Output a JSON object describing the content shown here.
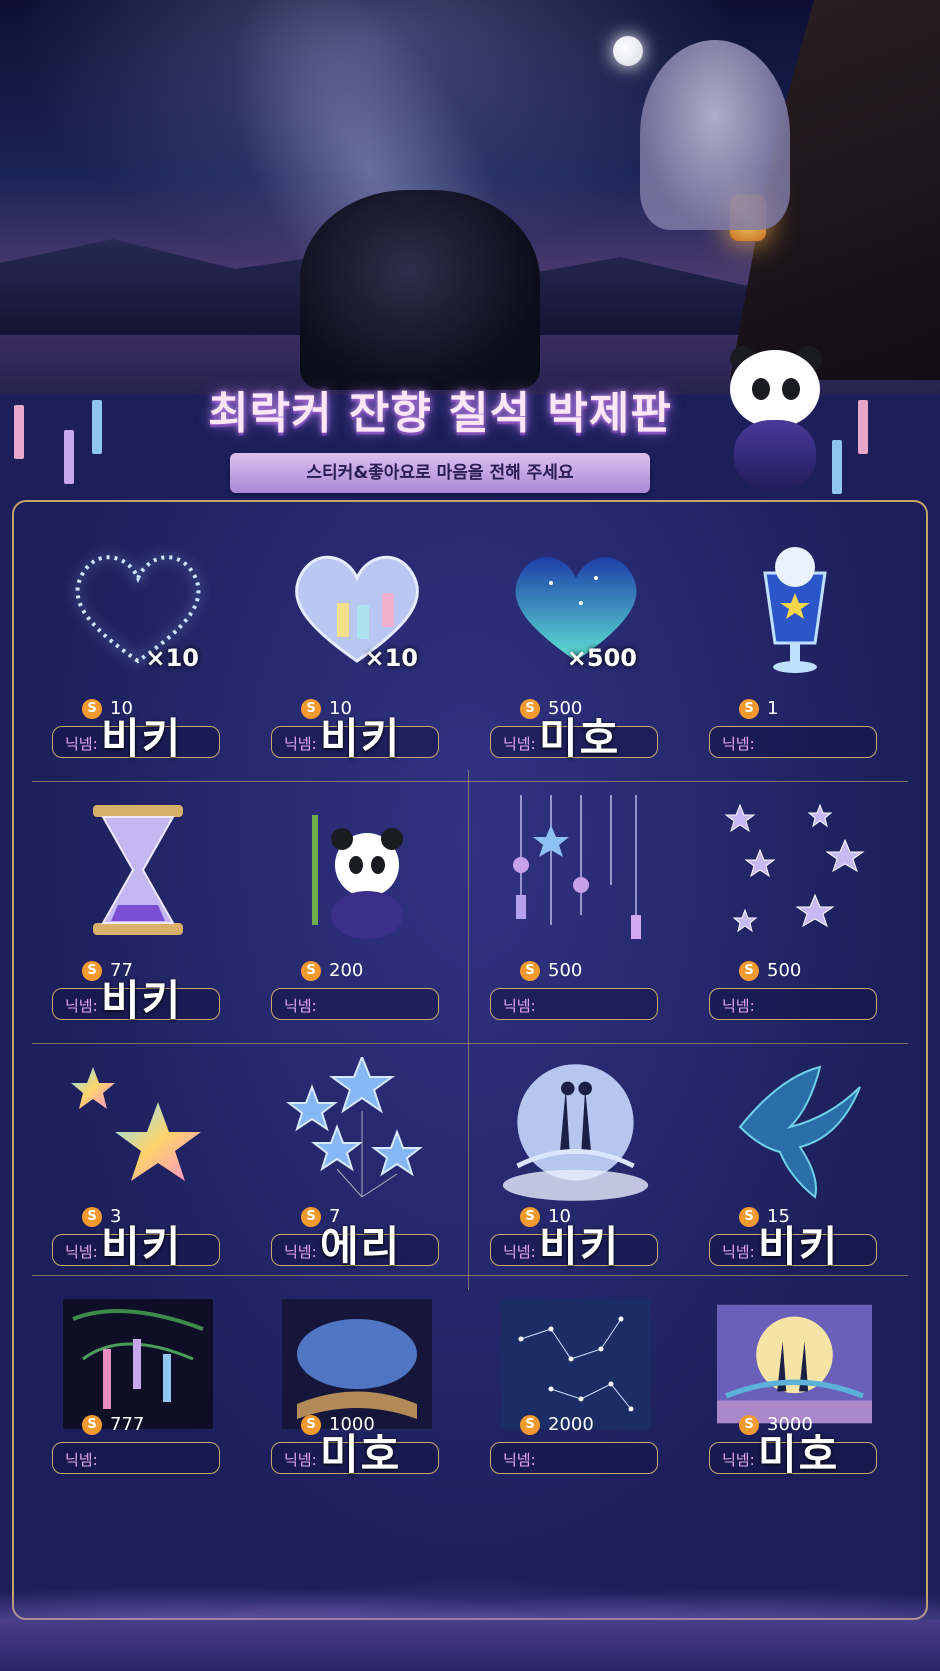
{
  "title": "최락커 잔향 칠석 박제판",
  "subtitle": "스티커&좋아요로 마음을 전해 주세요",
  "coin_symbol": "S",
  "nickname_label": "닉넴:",
  "colors": {
    "accent": "#c9a76d",
    "coin": "#f29a2e",
    "label": "#e8a7f0",
    "background": "#1c1f5a"
  },
  "rows": [
    [
      {
        "icon": "sparkle-heart-icon",
        "multiplier": "×10",
        "price": "10",
        "nickname": "비키"
      },
      {
        "icon": "glass-heart-icon",
        "multiplier": "×10",
        "price": "10",
        "nickname": "비키"
      },
      {
        "icon": "starry-heart-icon",
        "multiplier": "×500",
        "price": "500",
        "nickname": "미호"
      },
      {
        "icon": "starry-drink-icon",
        "multiplier": "",
        "price": "1",
        "nickname": ""
      }
    ],
    [
      {
        "icon": "hourglass-icon",
        "multiplier": "",
        "price": "77",
        "nickname": "비키"
      },
      {
        "icon": "panda-bamboo-icon",
        "multiplier": "",
        "price": "200",
        "nickname": ""
      },
      {
        "icon": "wind-chimes-icon",
        "multiplier": "",
        "price": "500",
        "nickname": ""
      },
      {
        "icon": "scattered-stars-icon",
        "multiplier": "",
        "price": "500",
        "nickname": ""
      }
    ],
    [
      {
        "icon": "rainbow-stars-icon",
        "multiplier": "",
        "price": "3",
        "nickname": "비키"
      },
      {
        "icon": "star-balloons-icon",
        "multiplier": "",
        "price": "7",
        "nickname": "에리"
      },
      {
        "icon": "moon-couple-icon",
        "multiplier": "",
        "price": "10",
        "nickname": "비키"
      },
      {
        "icon": "magpie-icon",
        "multiplier": "",
        "price": "15",
        "nickname": "비키"
      }
    ],
    [
      {
        "icon": "tanabata-bamboo-icon",
        "multiplier": "",
        "price": "777",
        "nickname": ""
      },
      {
        "icon": "magic-book-icon",
        "multiplier": "",
        "price": "1000",
        "nickname": "미호"
      },
      {
        "icon": "constellation-icon",
        "multiplier": "",
        "price": "2000",
        "nickname": ""
      },
      {
        "icon": "bridge-couple-icon",
        "multiplier": "",
        "price": "3000",
        "nickname": "미호"
      }
    ]
  ]
}
